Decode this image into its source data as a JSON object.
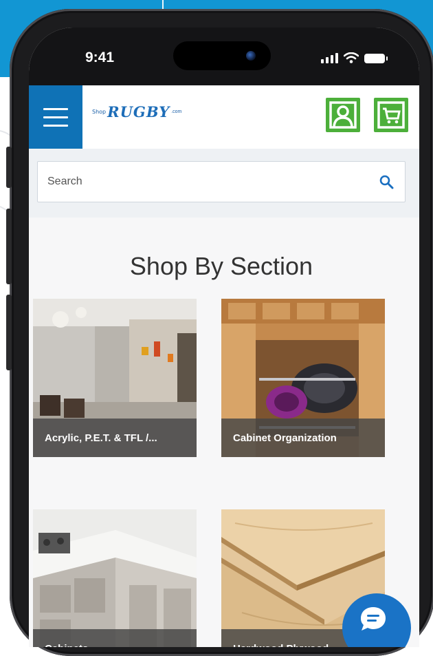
{
  "status_bar": {
    "time": "9:41"
  },
  "header": {
    "logo_prefix": "Shop",
    "logo_brand": "RUGBY",
    "logo_suffix": ".com"
  },
  "search": {
    "placeholder": "Search"
  },
  "main": {
    "section_title": "Shop By Section",
    "categories": [
      {
        "label": "Acrylic, P.E.T. & TFL /..."
      },
      {
        "label": "Cabinet Organization"
      },
      {
        "label": "Cabinets"
      },
      {
        "label": "Hardwood Plywood"
      }
    ]
  },
  "icons": {
    "menu": "hamburger-menu-icon",
    "account": "user-account-icon",
    "cart": "shopping-cart-icon",
    "search": "search-icon",
    "chat": "chat-bubble-icon"
  },
  "colors": {
    "menu_blue": "#0f72b6",
    "brand_green": "#4caf3a",
    "chat_blue": "#1a73c6",
    "background_blue": "#1296d3"
  }
}
